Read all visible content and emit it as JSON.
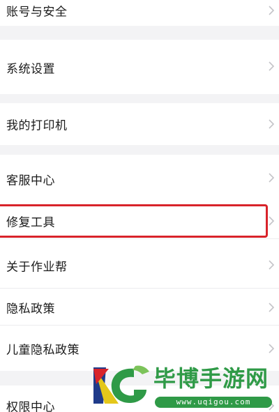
{
  "settings": {
    "items": [
      {
        "key": "account",
        "label": "账号与安全"
      },
      {
        "key": "system",
        "label": "系统设置"
      },
      {
        "key": "printer",
        "label": "我的打印机"
      },
      {
        "key": "support",
        "label": "客服中心"
      },
      {
        "key": "repair",
        "label": "修复工具"
      },
      {
        "key": "about",
        "label": "关于作业帮"
      },
      {
        "key": "privacy",
        "label": "隐私政策"
      },
      {
        "key": "child-privacy",
        "label": "儿童隐私政策"
      },
      {
        "key": "permissions",
        "label": "权限中心"
      }
    ],
    "chevron_icon": "chevron-right-icon",
    "highlighted_item": "修复工具",
    "highlight_color": "#d8232a"
  },
  "watermark": {
    "title": "毕博手游网",
    "url": "www.uqigou.com",
    "color": "#2f9a47"
  }
}
